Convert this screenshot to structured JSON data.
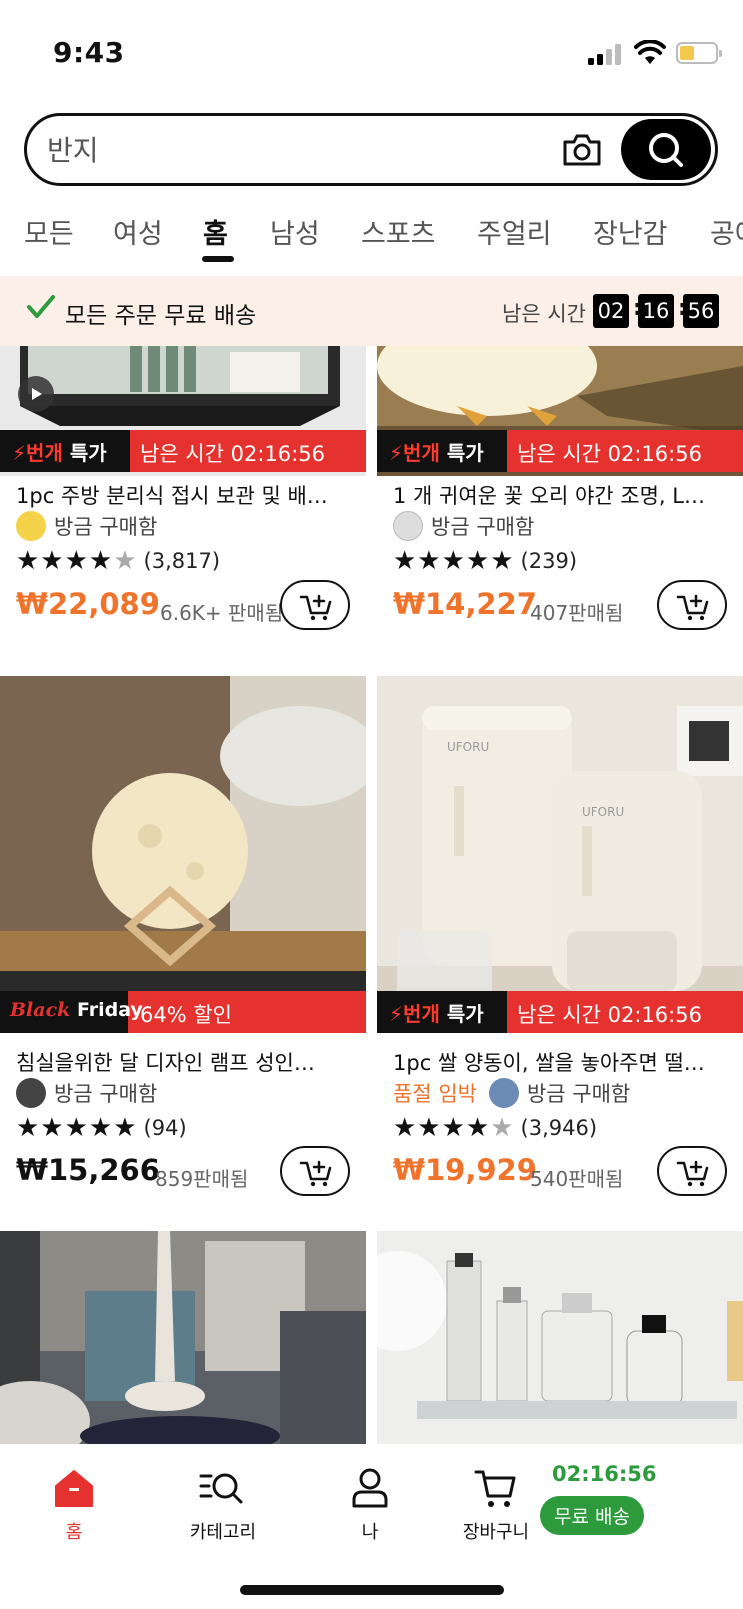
{
  "status_bar": {
    "time": "9:43"
  },
  "search": {
    "placeholder": "반지"
  },
  "tabs": [
    "모든",
    "여성",
    "홈",
    "남성",
    "스포츠",
    "주얼리",
    "장난감",
    "공예"
  ],
  "active_tab": "홈",
  "banner": {
    "message": "모든 주문 무료 배송",
    "remaining_label": "남은 시간",
    "hh": "02",
    "mm": "16",
    "ss": "56"
  },
  "promo": {
    "flash_a": "번개",
    "flash_b": "특가",
    "countdown": "남은 시간 02:16:56",
    "bf_a": "Black",
    "bf_b": "Friday",
    "discount": "64% 할인"
  },
  "products": [
    {
      "title": "1pc 주방 분리식 접시 보관 및 배…",
      "buyer": "방금 구매함",
      "rating": 4.5,
      "reviews": "(3,817)",
      "price": "₩22,089",
      "sold": "6.6K+ 판매됨"
    },
    {
      "title": "1 개 귀여운 꽃 오리 야간 조명, L…",
      "buyer": "방금 구매함",
      "rating": 5,
      "reviews": "(239)",
      "price": "₩14,227",
      "sold": "407판매됨"
    },
    {
      "title": "침실을위한 달 디자인 램프 성인…",
      "buyer": "방금 구매함",
      "rating": 5,
      "reviews": "(94)",
      "price": "₩15,266",
      "sold": "859판매됨"
    },
    {
      "title": "1pc 쌀 양동이, 쌀을 놓아주면 떨…",
      "soldout_tag": "품절 임박",
      "buyer": "방금 구매함",
      "rating": 4.5,
      "reviews": "(3,946)",
      "price": "₩19,929",
      "sold": "540판매됨"
    }
  ],
  "image_brand_text": "UFORU",
  "bottom_nav": {
    "home": "홈",
    "category": "카테고리",
    "me": "나",
    "cart": "장바구니",
    "timer": "02:16:56",
    "free_shipping": "무료 배송"
  },
  "colors": {
    "accent_orange": "#f0732b",
    "promo_red": "#e5322e",
    "green": "#2d9a3c",
    "banner_bg": "#fbefe7"
  }
}
